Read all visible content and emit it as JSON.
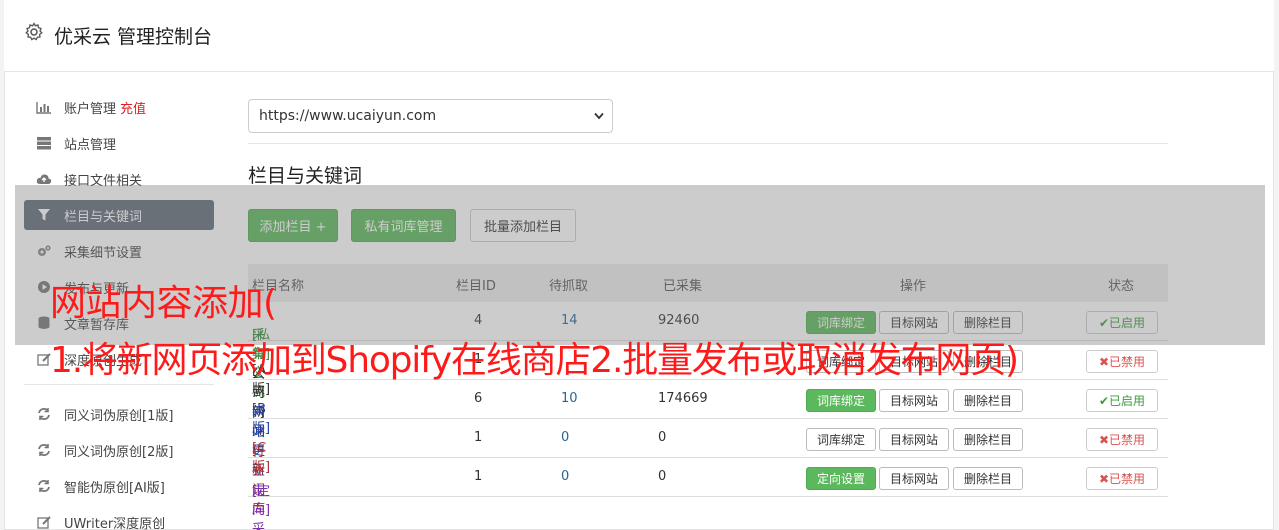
{
  "header": {
    "title": "优采云 管理控制台"
  },
  "sidebar": {
    "items": [
      {
        "label": "账户管理",
        "extra": "充值",
        "icon": "bar-chart-icon"
      },
      {
        "label": "站点管理",
        "icon": "server-icon"
      },
      {
        "label": "接口文件相关",
        "icon": "cloud-upload-icon"
      },
      {
        "label": "栏目与关键词",
        "icon": "filter-icon"
      },
      {
        "label": "采集细节设置",
        "icon": "cogs-icon"
      },
      {
        "label": "发布与更新",
        "icon": "play-circle-icon"
      },
      {
        "label": "文章暂存库",
        "icon": "database-icon"
      },
      {
        "label": "深度原创生成",
        "icon": "edit-icon"
      }
    ],
    "tools": [
      {
        "label": "同义词伪原创[1版]",
        "icon": "refresh-icon"
      },
      {
        "label": "同义词伪原创[2版]",
        "icon": "refresh-icon"
      },
      {
        "label": "智能伪原创[AI版]",
        "icon": "refresh-icon"
      },
      {
        "label": "UWriter深度原创",
        "icon": "edit-icon"
      }
    ]
  },
  "main": {
    "site_select": "https://www.ucaiyun.com",
    "section_title": "栏目与关键词",
    "buttons": {
      "add": "添加栏目 +",
      "private": "私有词库管理",
      "batch": "批量添加栏目"
    },
    "table": {
      "headers": {
        "name": "栏目名称",
        "id": "栏目ID",
        "pending": "待抓取",
        "collected": "已采集",
        "ops": "操作",
        "status": "状态"
      },
      "rows": [
        {
          "tag": "[私有]",
          "name": "采集交流",
          "id": "4",
          "pending": "14",
          "collected": "92460",
          "op1": "词库绑定",
          "op1_primary": true,
          "op2": "目标网站",
          "op3": "删除栏目",
          "status": "✔已启用",
          "on": true,
          "color": "#3c8c3c"
        },
        {
          "tag": "[A版]",
          "name": "公司新闻",
          "id": "1",
          "pending": "",
          "collected": "",
          "op1": "词库绑定",
          "op1_primary": false,
          "op2": "目标网站",
          "op3": "删除栏目",
          "status": "✖已禁用",
          "on": false,
          "color": "#333333"
        },
        {
          "tag": "[B版]",
          "name": "网站更新",
          "id": "6",
          "pending": "10",
          "collected": "174669",
          "op1": "词库绑定",
          "op1_primary": true,
          "op2": "目标网站",
          "op3": "删除栏目",
          "status": "✔已启用",
          "on": true,
          "color": "#1f3fa8"
        },
        {
          "tag": "[C版]",
          "name": "行业词库",
          "id": "1",
          "pending": "0",
          "collected": "0",
          "op1": "词库绑定",
          "op1_primary": false,
          "op2": "目标网站",
          "op3": "删除栏目",
          "status": "✖已禁用",
          "on": false,
          "color": "#a83232"
        },
        {
          "tag": "[定向]",
          "name": "定向采集",
          "id": "1",
          "pending": "0",
          "collected": "0",
          "op1": "定向设置",
          "op1_primary": true,
          "op2": "目标网站",
          "op3": "删除栏目",
          "status": "✖已禁用",
          "on": false,
          "color": "#7b2fb0"
        }
      ]
    }
  },
  "overlay": {
    "line1": "网站内容添加(",
    "line2": "1.将新网页添加到Shopify在线商店2.批量发布或取消发布网页)"
  }
}
